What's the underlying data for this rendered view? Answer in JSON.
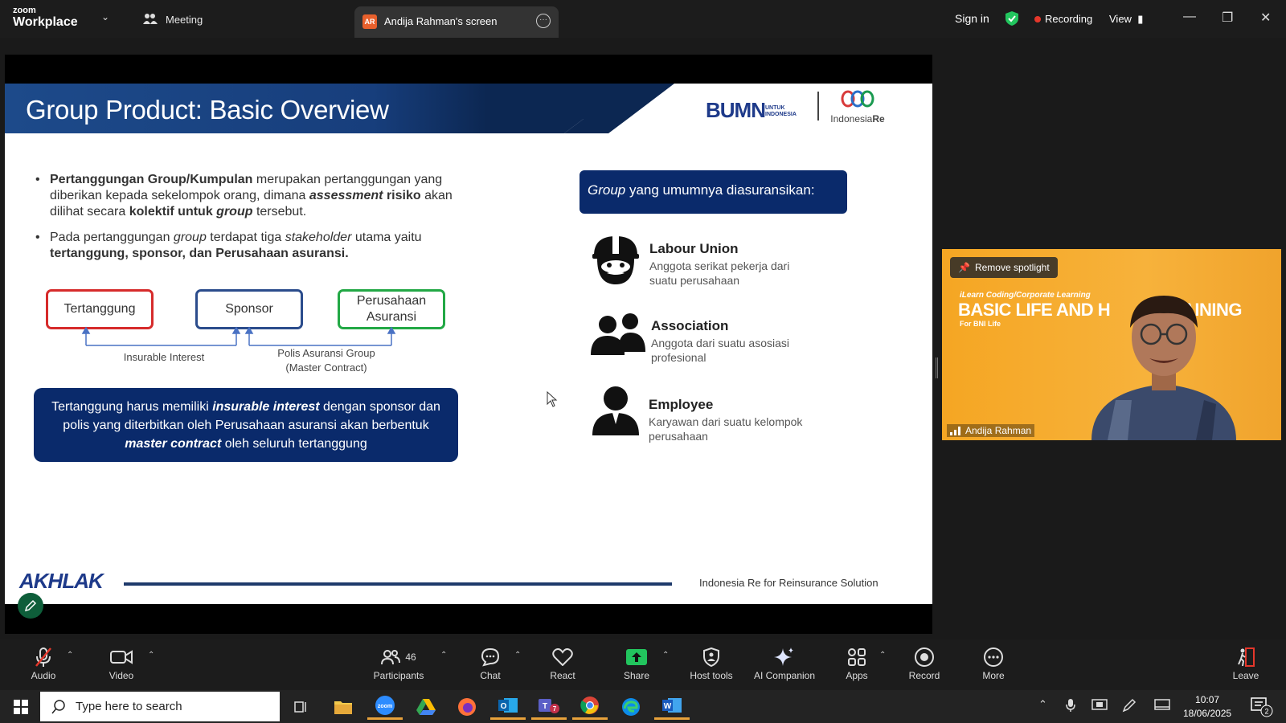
{
  "app": {
    "brand_top": "zoom",
    "brand_bottom": "Workplace"
  },
  "tabs": {
    "meeting": "Meeting",
    "screen_avatar": "AR",
    "screen": "Andija Rahman's screen"
  },
  "header": {
    "sign_in": "Sign in",
    "recording": "Recording",
    "view": "View"
  },
  "slide": {
    "title": "Group Product: Basic Overview",
    "logo_bumn": "BUMN",
    "logo_bumn_small1": "UNTUK",
    "logo_bumn_small2": "INDONESIA",
    "logo_ire_a": "Indonesia",
    "logo_ire_b": "Re",
    "bullet1_a": "Pertanggungan Group/Kumpulan",
    "bullet1_b": " merupakan pertanggungan yang diberikan kepada sekelompok orang, dimana ",
    "bullet1_c": "assessment",
    "bullet1_d": " risiko",
    "bullet1_e": " akan dilihat secara ",
    "bullet1_f": "kolektif untuk ",
    "bullet1_g": "group",
    "bullet1_h": " tersebut.",
    "bullet2_a": "Pada pertanggungan ",
    "bullet2_b": "group",
    "bullet2_c": " terdapat tiga ",
    "bullet2_d": "stakeholder",
    "bullet2_e": " utama yaitu ",
    "bullet2_f": "tertanggung, sponsor, dan Perusahaan asuransi.",
    "box_tertanggung": "Tertanggung",
    "box_sponsor": "Sponsor",
    "box_perusahaan_1": "Perusahaan",
    "box_perusahaan_2": "Asuransi",
    "note_insurable": "Insurable Interest",
    "note_polis_1": "Polis Asuransi Group",
    "note_polis_2": "(Master Contract)",
    "callout_a": "Tertanggung harus memiliki ",
    "callout_b": "insurable interest",
    "callout_c": " dengan sponsor dan polis yang diterbitkan oleh Perusahaan asuransi akan berbentuk ",
    "callout_d": "master contract",
    "callout_e": " oleh seluruh tertanggung",
    "group_head_a": "Group",
    "group_head_b": " yang umumnya diasuransikan:",
    "groups": [
      {
        "title": "Labour Union",
        "desc1": "Anggota serikat pekerja dari",
        "desc2": "suatu perusahaan",
        "icon": "worker-icon"
      },
      {
        "title": "Association",
        "desc1": "Anggota dari suatu asosiasi",
        "desc2": "profesional",
        "icon": "people-icon"
      },
      {
        "title": "Employee",
        "desc1": "Karyawan dari suatu kelompok",
        "desc2": "perusahaan",
        "icon": "person-icon"
      }
    ],
    "akhlak": "AKHLAK",
    "footer": "Indonesia Re for Reinsurance Solution"
  },
  "video": {
    "spotlight": "Remove spotlight",
    "sub": "iLearn Coding/Corporate Learning",
    "title": "BASIC LIFE AND H",
    "title_end": "AINING",
    "sub2": "For BNI Life",
    "name": "Andija Rahman"
  },
  "toolbar": {
    "audio": "Audio",
    "video": "Video",
    "participants": "Participants",
    "participants_count": "46",
    "chat": "Chat",
    "react": "React",
    "share": "Share",
    "host_tools": "Host tools",
    "ai_companion": "AI Companion",
    "apps": "Apps",
    "record": "Record",
    "more": "More",
    "leave": "Leave"
  },
  "taskbar": {
    "search_placeholder": "Type here to search",
    "time": "10:07",
    "date": "18/06/2025",
    "notif_count": "2",
    "teams_badge": "7"
  },
  "colors": {
    "slide_navy": "#0a2a6b",
    "tertanggung": "#d62b2b",
    "sponsor": "#2b4c8c",
    "perusahaan": "#22a845",
    "video_orange": "#f5a623",
    "recording_red": "#e5372b",
    "share_green": "#22c55e"
  }
}
